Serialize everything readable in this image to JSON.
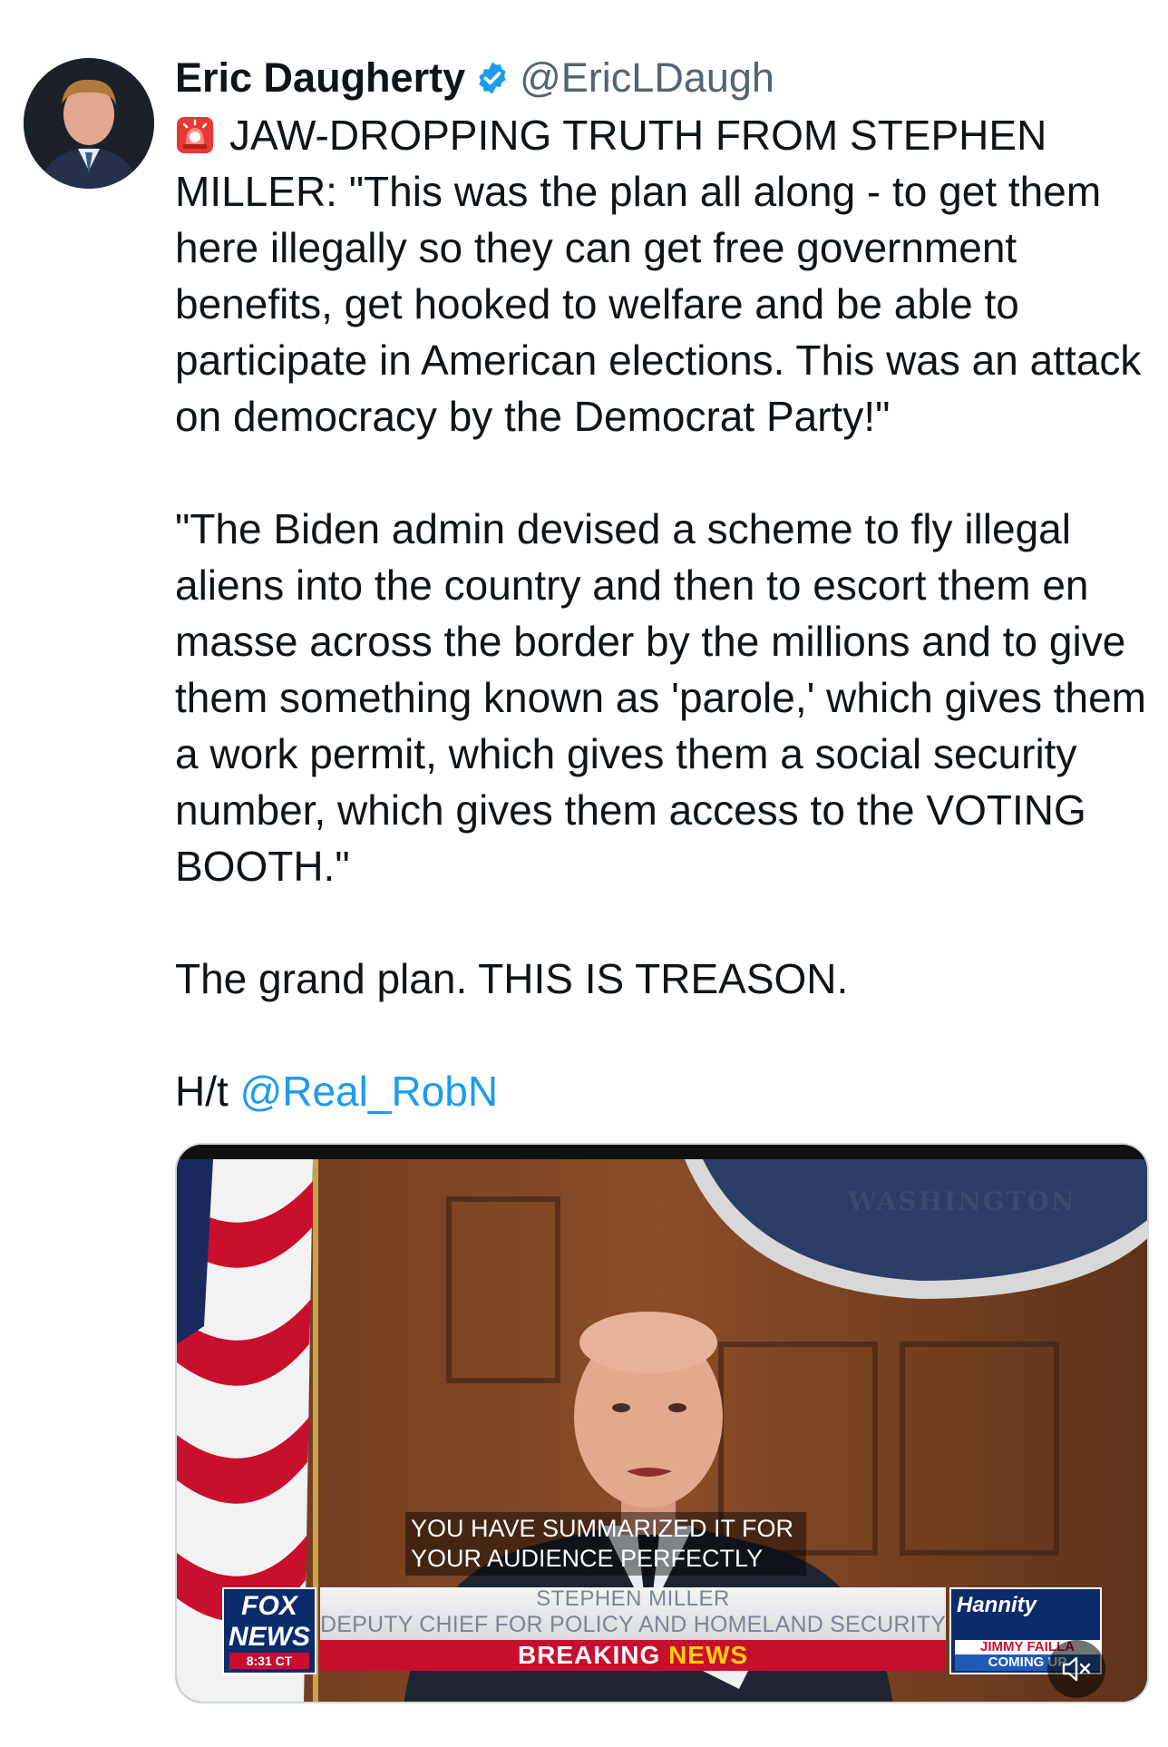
{
  "author": {
    "name": "Eric Daugherty",
    "handle": "@EricLDaugh",
    "verified": true
  },
  "tweet": {
    "emoji_icon": "rotating-light-icon",
    "paragraphs": [
      "JAW-DROPPING TRUTH FROM STEPHEN MILLER: \"This was the plan all along - to get them here illegally so they can get free government benefits, get hooked to welfare and be able to participate in American elections. This was an attack on democracy by the Democrat Party!\"",
      "\"The Biden admin devised a scheme to fly illegal aliens into the country and then to escort them en masse across the border by the millions and to give them something known as 'parole,' which gives them a work permit, which gives them a social security number, which gives them access to the VOTING BOOTH.\"",
      "The grand plan. THIS IS TREASON."
    ],
    "hat_tip_prefix": "H/t",
    "hat_tip_mention": "@Real_RobN"
  },
  "video": {
    "seal_text": "WASHINGTON",
    "caption": "YOU HAVE SUMMARIZED IT FOR YOUR AUDIENCE PERFECTLY",
    "chyron_name": "STEPHEN MILLER",
    "chyron_title": "DEPUTY CHIEF FOR POLICY AND HOMELAND SECURITY ADVISOR",
    "breaking_word1": "BREAKING",
    "breaking_word2": "NEWS",
    "network_top": "FOX",
    "network_bottom": "NEWS",
    "time": "8:31 CT",
    "promo_show": "Hannity",
    "promo_guest": "JIMMY FAILLA",
    "promo_status": "COMING UP",
    "mute_icon": "speaker-muted-icon"
  },
  "colors": {
    "verified_badge": "#1d9bf0",
    "mention": "#1d9bf0",
    "breaking_bar": "#c8102e",
    "news_yellow": "#ffd200"
  }
}
